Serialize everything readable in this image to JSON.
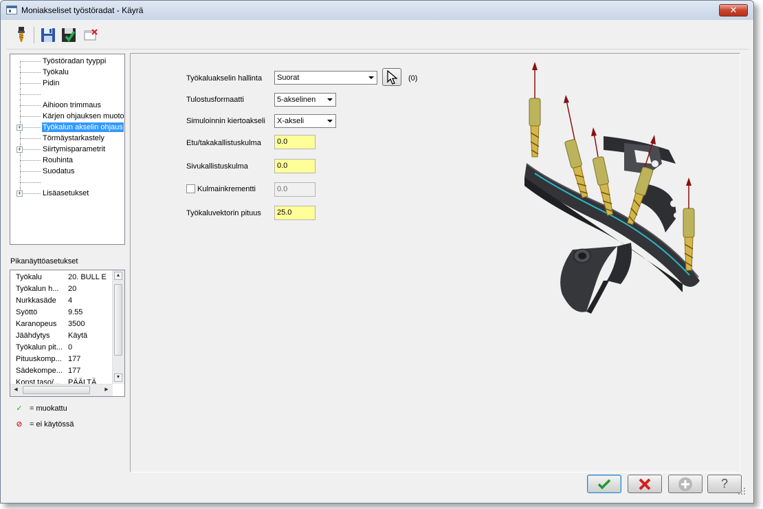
{
  "window": {
    "title": "Moniakseliset työstöradat - Käyrä",
    "close_label": "✕"
  },
  "toolbar": {
    "buttons": [
      "tool-icon",
      "save-icon",
      "save-and-calculate-icon",
      "delete-icon"
    ]
  },
  "tree": {
    "items": [
      {
        "label": "Työstöradan tyyppi",
        "expandable": false,
        "selected": false
      },
      {
        "label": "Työkalu",
        "expandable": false,
        "selected": false
      },
      {
        "label": "Pidin",
        "expandable": false,
        "selected": false
      },
      {
        "label": "",
        "expandable": false,
        "selected": false
      },
      {
        "label": "Aihioon trimmaus",
        "expandable": false,
        "selected": false
      },
      {
        "label": "Kärjen ohjauksen muoto",
        "expandable": false,
        "selected": false
      },
      {
        "label": "Työkalun akselin ohjaus",
        "expandable": true,
        "selected": true
      },
      {
        "label": "Törmäystarkastely",
        "expandable": false,
        "selected": false
      },
      {
        "label": "Siirtymisparametrit",
        "expandable": true,
        "selected": false
      },
      {
        "label": "Rouhinta",
        "expandable": false,
        "selected": false
      },
      {
        "label": "Suodatus",
        "expandable": false,
        "selected": false
      },
      {
        "label": "",
        "expandable": false,
        "selected": false
      },
      {
        "label": "Lisäasetukset",
        "expandable": true,
        "selected": false
      }
    ]
  },
  "quick_settings": {
    "title": "Pikanäyttöasetukset",
    "rows": [
      {
        "key": "Työkalu",
        "value": "20. BULL E"
      },
      {
        "key": "Työkalun h...",
        "value": "20"
      },
      {
        "key": "Nurkkasäde",
        "value": "4"
      },
      {
        "key": "Syöttö",
        "value": "9.55"
      },
      {
        "key": "Karanopeus",
        "value": "3500"
      },
      {
        "key": "Jäähdytys",
        "value": "Käytä"
      },
      {
        "key": "Työkalun pit...",
        "value": "0"
      },
      {
        "key": "Pituuskomp...",
        "value": "177"
      },
      {
        "key": "Sädekompe...",
        "value": "177"
      },
      {
        "key": "Konst.taso/...",
        "value": "PÄÄLTÄ"
      }
    ]
  },
  "legend": {
    "modified_label": "= muokattu",
    "disabled_label": "= ei käytössä",
    "modified_color": "#2aa32a",
    "disabled_color": "#d42020"
  },
  "form": {
    "tool_axis_control_label": "Työkaluakselin hallinta",
    "tool_axis_control_value": "Suorat",
    "pick_count": "(0)",
    "output_format_label": "Tulostusformaatti",
    "output_format_value": "5-akselinen",
    "sim_rotation_axis_label": "Simuloinnin kiertoakseli",
    "sim_rotation_axis_value": "X-akseli",
    "lead_lag_angle_label": "Etu/takakallistuskulma",
    "lead_lag_angle_value": "0.0",
    "side_tilt_angle_label": "Sivukallistuskulma",
    "side_tilt_angle_value": "0.0",
    "angle_increment_label": "Kulmainkrementti",
    "angle_increment_value": "0.0",
    "angle_increment_checked": false,
    "tool_vector_length_label": "Työkaluvektorin pituus",
    "tool_vector_length_value": "25.0"
  },
  "buttons": {
    "ok": "check-icon",
    "cancel": "x-icon",
    "add": "plus-icon",
    "help": "?"
  },
  "colors": {
    "highlight": "#3399ff",
    "input_highlight": "#ffff99",
    "part_body": "#3a3b3f",
    "curve": "#2bb7c9",
    "tool_shank": "#bdb35a",
    "tool_flute": "#d4b64a",
    "vector": "#8a1010"
  }
}
